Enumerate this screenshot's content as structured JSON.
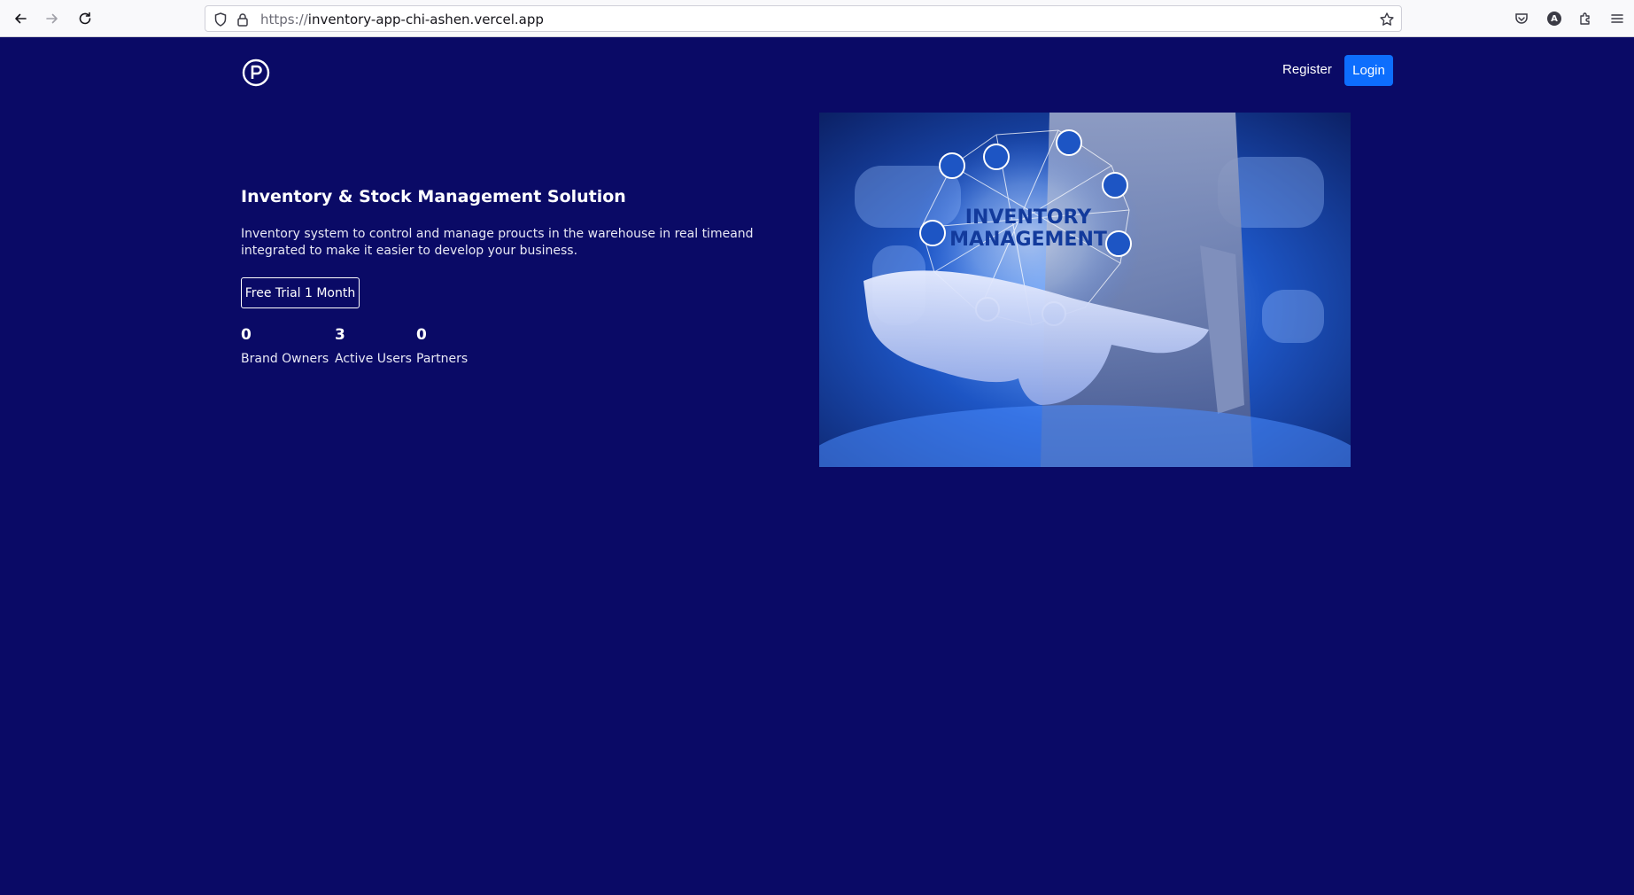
{
  "browser": {
    "url_scheme": "https://",
    "url_host": "inventory-app-chi-ashen.vercel.app",
    "account_initial": "A"
  },
  "header": {
    "register_label": "Register",
    "login_label": "Login"
  },
  "hero": {
    "title": "Inventory & Stock Management Solution",
    "description": "Inventory system to control and manage proucts in the warehouse in real timeand integrated to make it easier to develop your business.",
    "cta_label": "Free Trial 1 Month",
    "stats": [
      {
        "value": "0",
        "label": "Brand Owners"
      },
      {
        "value": "3",
        "label": "Active Users"
      },
      {
        "value": "0",
        "label": "Partners"
      }
    ],
    "image_text_line1": "INVENTORY",
    "image_text_line2": "MANAGEMENT"
  },
  "colors": {
    "page_bg": "#0a0a66",
    "login_bg": "#0d6efd"
  },
  "icons": [
    "back-icon",
    "forward-icon",
    "reload-icon",
    "shield-icon",
    "lock-icon",
    "star-icon",
    "pocket-icon",
    "extensions-icon",
    "menu-icon",
    "logo-p-icon"
  ]
}
